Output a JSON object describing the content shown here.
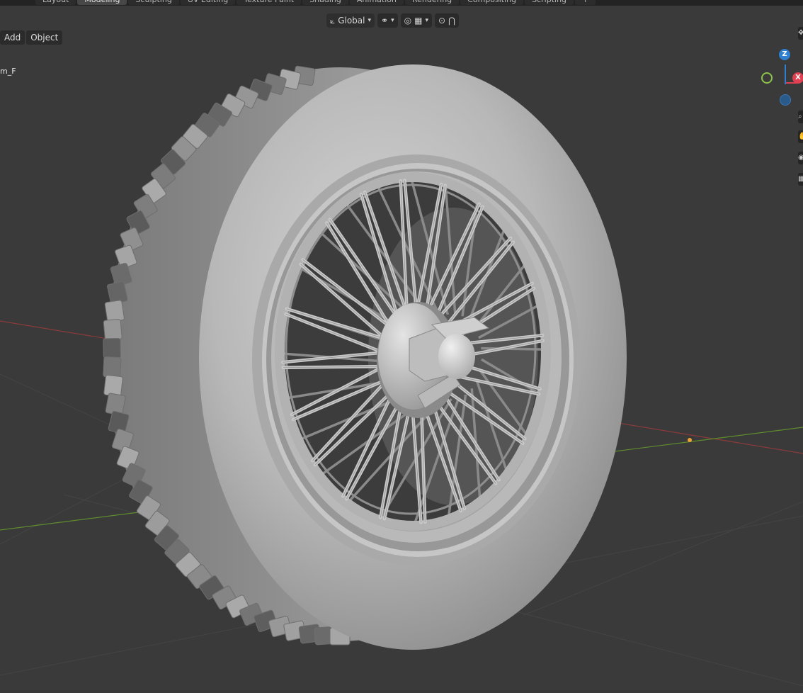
{
  "workspace_tabs": [
    "Layout",
    "Modeling",
    "Sculpting",
    "UV Editing",
    "Texture Paint",
    "Shading",
    "Animation",
    "Rendering",
    "Compositing",
    "Scripting",
    "+"
  ],
  "active_tab_index": 1,
  "header": {
    "menus": [
      {
        "name": "add-menu",
        "label": "Add"
      },
      {
        "name": "object-menu",
        "label": "Object"
      }
    ],
    "transform_orientation": "Global"
  },
  "viewport": {
    "object_name_partial": "m_F"
  },
  "gizmo": {
    "z_label": "Z",
    "x_label": "X",
    "z_color": "#2f7fd0",
    "x_color": "#e04052",
    "y_color": "#8bc34a"
  },
  "icons": {
    "orientation": "transform-orientation-icon",
    "pivot": "pivot-link-icon",
    "snap": "snap-magnet-icon",
    "snap_target": "snap-grid-icon",
    "proportional": "proportional-edit-icon",
    "falloff": "falloff-curve-icon"
  },
  "colors": {
    "viewport_bg": "#3a3a3a",
    "tire_main": "#b4b4b4",
    "axis_x": "#a84545",
    "axis_y": "#6f9a35",
    "origin": "#f0a030"
  }
}
